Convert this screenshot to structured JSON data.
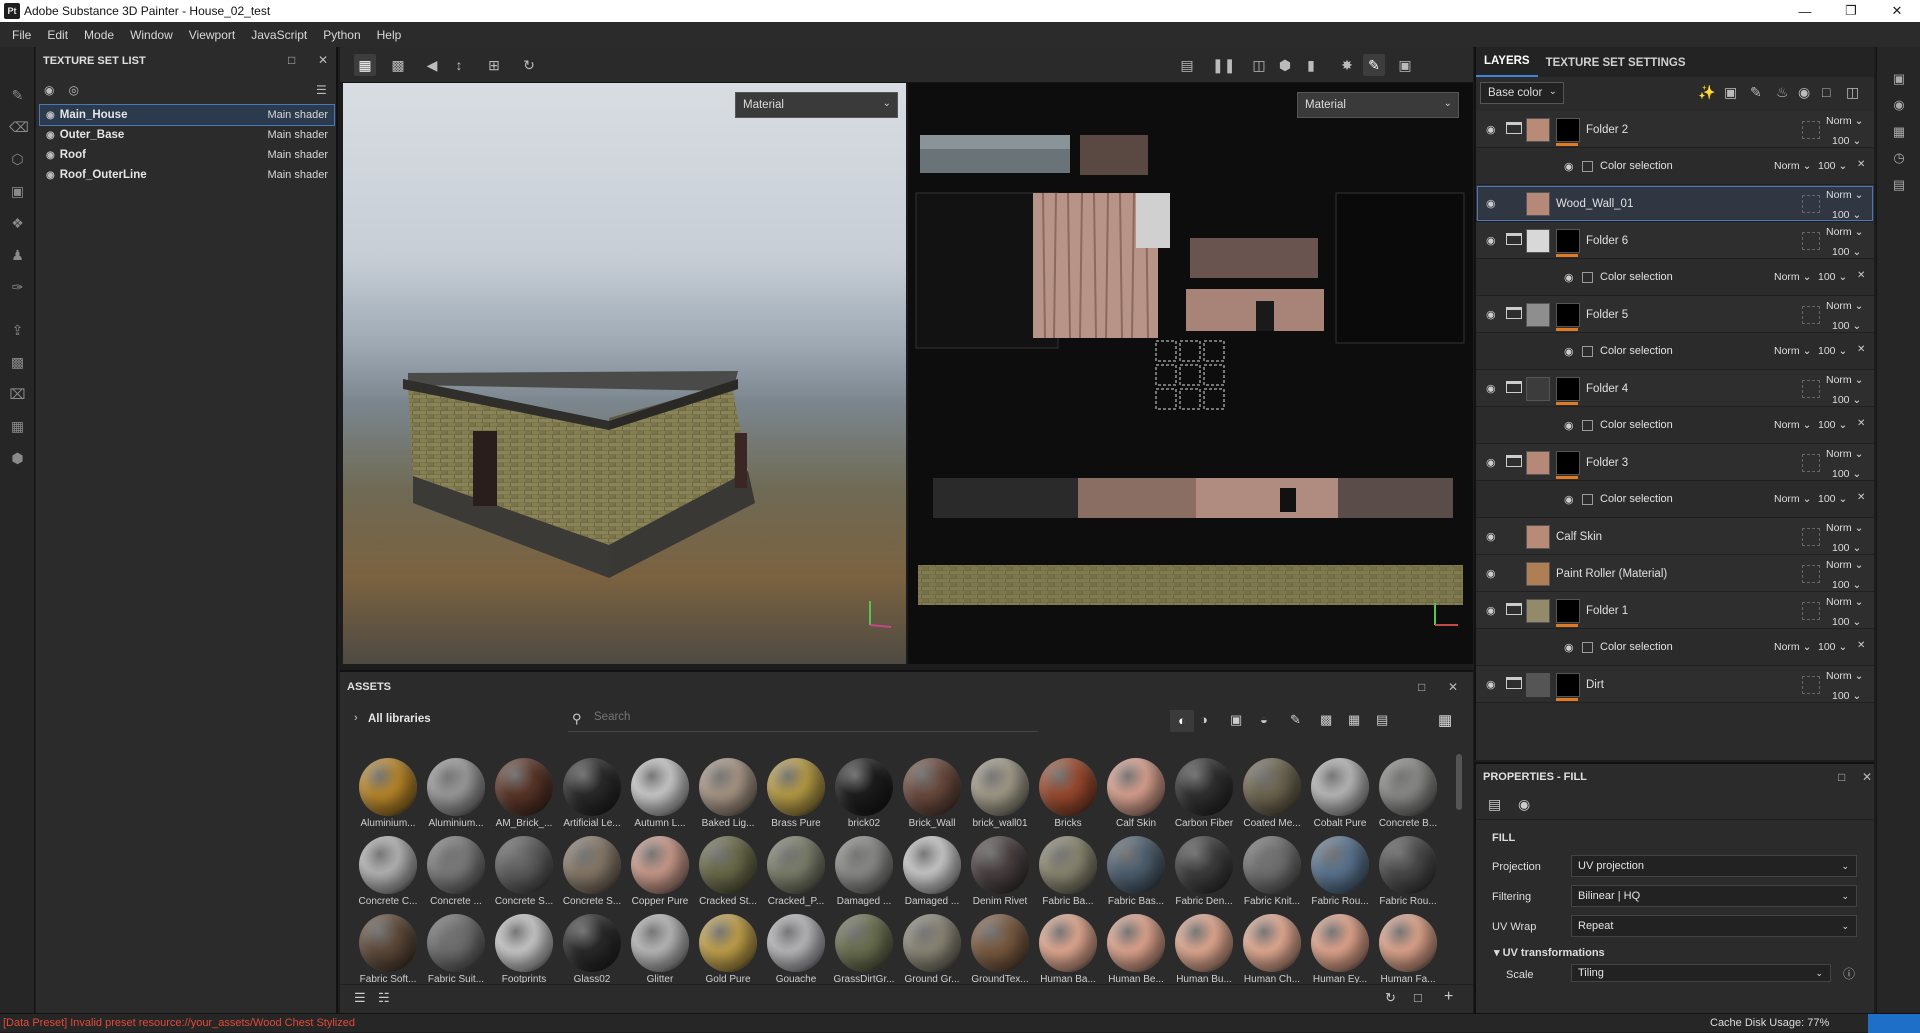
{
  "window": {
    "title": "Adobe Substance 3D Painter - House_02_test",
    "app_icon": "Pt"
  },
  "menu": [
    "File",
    "Edit",
    "Mode",
    "Window",
    "Viewport",
    "JavaScript",
    "Python",
    "Help"
  ],
  "texture_set_list": {
    "title": "TEXTURE SET LIST",
    "items": [
      {
        "name": "Main_House",
        "shader": "Main shader",
        "selected": true
      },
      {
        "name": "Outer_Base",
        "shader": "Main shader"
      },
      {
        "name": "Roof",
        "shader": "Main shader"
      },
      {
        "name": "Roof_OuterLine",
        "shader": "Main shader"
      }
    ]
  },
  "viewport": {
    "left_mode": "Material",
    "right_mode": "Material"
  },
  "layers_panel": {
    "tabs": [
      "LAYERS",
      "TEXTURE SET SETTINGS"
    ],
    "channel": "Base color",
    "rows": [
      {
        "type": "folder",
        "name": "Folder 2",
        "blend": "Norm",
        "opacity": "100",
        "swatch": "#b98a75"
      },
      {
        "type": "sub",
        "name": "Color selection",
        "blend": "Norm",
        "opacity": "100"
      },
      {
        "type": "layer",
        "name": "Wood_Wall_01",
        "blend": "Norm",
        "opacity": "100",
        "swatch": "#b58878",
        "selected": true
      },
      {
        "type": "folder",
        "name": "Folder 6",
        "blend": "Norm",
        "opacity": "100",
        "swatch": "#d8d8d8"
      },
      {
        "type": "sub",
        "name": "Color selection",
        "blend": "Norm",
        "opacity": "100"
      },
      {
        "type": "folder",
        "name": "Folder 5",
        "blend": "Norm",
        "opacity": "100",
        "swatch": "#8e8e8e"
      },
      {
        "type": "sub",
        "name": "Color selection",
        "blend": "Norm",
        "opacity": "100"
      },
      {
        "type": "folder",
        "name": "Folder 4",
        "blend": "Norm",
        "opacity": "100",
        "swatch": "#3c3c3c"
      },
      {
        "type": "sub",
        "name": "Color selection",
        "blend": "Norm",
        "opacity": "100"
      },
      {
        "type": "folder",
        "name": "Folder 3",
        "blend": "Norm",
        "opacity": "100",
        "swatch": "#b58878"
      },
      {
        "type": "sub",
        "name": "Color selection",
        "blend": "Norm",
        "opacity": "100"
      },
      {
        "type": "layer",
        "name": "Calf Skin",
        "blend": "Norm",
        "opacity": "100",
        "swatch": "#b98a75"
      },
      {
        "type": "layer",
        "name": "Paint Roller (Material)",
        "blend": "Norm",
        "opacity": "100",
        "swatch": "#b07e55"
      },
      {
        "type": "folder",
        "name": "Folder 1",
        "blend": "Norm",
        "opacity": "100",
        "swatch": "#938a6a"
      },
      {
        "type": "sub",
        "name": "Color selection",
        "blend": "Norm",
        "opacity": "100"
      },
      {
        "type": "folder",
        "name": "Dirt",
        "blend": "Norm",
        "opacity": "100",
        "swatch": "#555555"
      }
    ]
  },
  "properties": {
    "title": "PROPERTIES - FILL",
    "section": "FILL",
    "projection_label": "Projection",
    "projection": "UV projection",
    "filtering_label": "Filtering",
    "filtering": "Bilinear | HQ",
    "uvwrap_label": "UV Wrap",
    "uvwrap": "Repeat",
    "uvtrans_label": "UV transformations",
    "scale_label": "Scale",
    "scale": "Tiling"
  },
  "assets": {
    "title": "ASSETS",
    "library": "All libraries",
    "search_placeholder": "Search",
    "rows": [
      [
        {
          "n": "Aluminium...",
          "c": "#b8862a"
        },
        {
          "n": "Aluminium...",
          "c": "#9a9a9a"
        },
        {
          "n": "AM_Brick_...",
          "c": "#5a3528"
        },
        {
          "n": "Artificial Le...",
          "c": "#2a2a2a"
        },
        {
          "n": "Autumn L...",
          "c": "#c9c9c9"
        },
        {
          "n": "Baked Lig...",
          "c": "#a69585"
        },
        {
          "n": "Brass Pure",
          "c": "#b59b45"
        },
        {
          "n": "brick02",
          "c": "#1d1d1d"
        },
        {
          "n": "Brick_Wall",
          "c": "#6b4a3e"
        },
        {
          "n": "brick_wall01",
          "c": "#a09a88"
        },
        {
          "n": "Bricks",
          "c": "#9a4a2e"
        },
        {
          "n": "Calf Skin",
          "c": "#d8a08e"
        },
        {
          "n": "Carbon Fiber",
          "c": "#303030"
        },
        {
          "n": "Coated Me...",
          "c": "#6e6650"
        },
        {
          "n": "Cobalt Pure",
          "c": "#b8b8b8"
        },
        {
          "n": "Concrete B...",
          "c": "#8a8a88"
        }
      ],
      [
        {
          "n": "Concrete C...",
          "c": "#b4b4b4"
        },
        {
          "n": "Concrete ...",
          "c": "#7a7a7a"
        },
        {
          "n": "Concrete S...",
          "c": "#5e5e5e"
        },
        {
          "n": "Concrete S...",
          "c": "#867868"
        },
        {
          "n": "Copper Pure",
          "c": "#c99a8a"
        },
        {
          "n": "Cracked St...",
          "c": "#6a6a4a"
        },
        {
          "n": "Cracked_P...",
          "c": "#7a7e6a"
        },
        {
          "n": "Damaged ...",
          "c": "#8a8a88"
        },
        {
          "n": "Damaged ...",
          "c": "#c8c8c8"
        },
        {
          "n": "Denim Rivet",
          "c": "#4a4040"
        },
        {
          "n": "Fabric Ba...",
          "c": "#8a8670"
        },
        {
          "n": "Fabric Bas...",
          "c": "#4e6070"
        },
        {
          "n": "Fabric Den...",
          "c": "#3e3e3e"
        },
        {
          "n": "Fabric Knit...",
          "c": "#707070"
        },
        {
          "n": "Fabric Rou...",
          "c": "#5a7490"
        },
        {
          "n": "Fabric Rou...",
          "c": "#4a4a4a"
        }
      ],
      [
        {
          "n": "Fabric Soft...",
          "c": "#5e4a3a"
        },
        {
          "n": "Fabric Suit...",
          "c": "#6e6e6e"
        },
        {
          "n": "Footprints",
          "c": "#c8c8c8"
        },
        {
          "n": "Glass02",
          "c": "#2a2a2a"
        },
        {
          "n": "Glitter",
          "c": "#b8b8b8"
        },
        {
          "n": "Gold Pure",
          "c": "#c0a04a"
        },
        {
          "n": "Gouache",
          "c": "#b8b8bc"
        },
        {
          "n": "GrassDirtGr...",
          "c": "#6a7050"
        },
        {
          "n": "Ground Gr...",
          "c": "#8a8676"
        },
        {
          "n": "GroundTex...",
          "c": "#7a5a40"
        },
        {
          "n": "Human Ba...",
          "c": "#e0a890"
        },
        {
          "n": "Human Be...",
          "c": "#dea48e"
        },
        {
          "n": "Human Bu...",
          "c": "#e0a890"
        },
        {
          "n": "Human Ch...",
          "c": "#e2aa92"
        },
        {
          "n": "Human Ey...",
          "c": "#e0a48c"
        },
        {
          "n": "Human Fa...",
          "c": "#dea48c"
        }
      ]
    ]
  },
  "status": {
    "error": "[Data Preset] Invalid preset resource://your_assets/Wood Chest Stylized",
    "cache_label": "Cache Disk Usage:",
    "cache_value": "77%"
  }
}
